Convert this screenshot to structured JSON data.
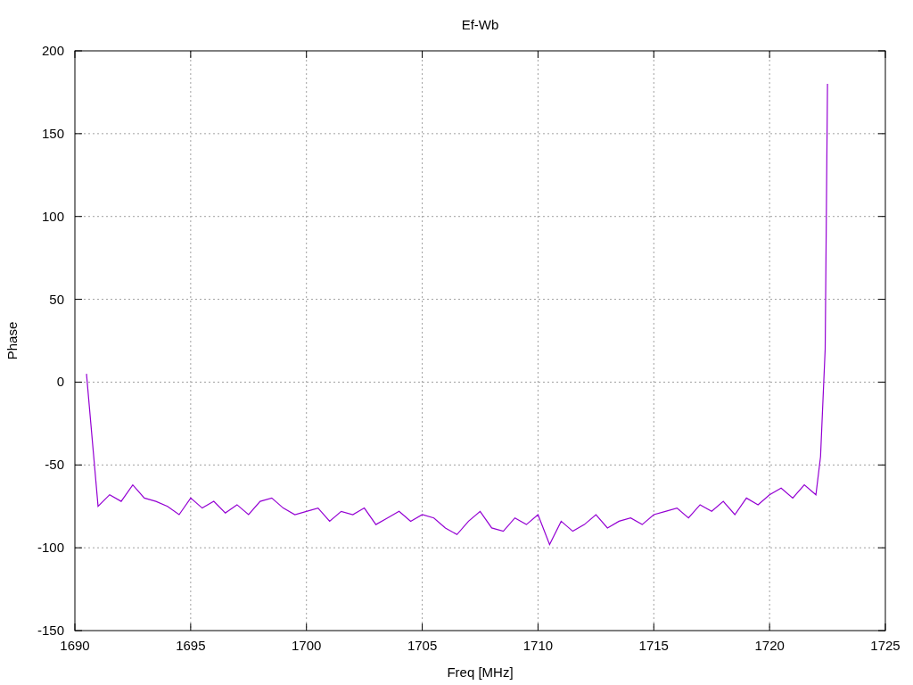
{
  "chart_data": {
    "type": "line",
    "title": "Ef-Wb",
    "xlabel": "Freq [MHz]",
    "ylabel": "Phase",
    "x": [
      1690.5,
      1691,
      1691.5,
      1692,
      1692.5,
      1693,
      1693.5,
      1694,
      1694.5,
      1695,
      1695.5,
      1696,
      1696.5,
      1697,
      1697.5,
      1698,
      1698.5,
      1699,
      1699.5,
      1700,
      1700.5,
      1701,
      1701.5,
      1702,
      1702.5,
      1703,
      1703.5,
      1704,
      1704.5,
      1705,
      1705.5,
      1706,
      1706.5,
      1707,
      1707.5,
      1708,
      1708.5,
      1709,
      1709.5,
      1710,
      1710.5,
      1711,
      1711.5,
      1712,
      1712.5,
      1713,
      1713.5,
      1714,
      1714.5,
      1715,
      1715.5,
      1716,
      1716.5,
      1717,
      1717.5,
      1718,
      1718.5,
      1719,
      1719.5,
      1720,
      1720.5,
      1721,
      1721.5,
      1722,
      1722.2,
      1722.4,
      1722.5
    ],
    "grid": true,
    "series": [
      {
        "color": "#9400d3",
        "values": [
          5,
          -75,
          -68,
          -72,
          -62,
          -70,
          -72,
          -75,
          -80,
          -70,
          -76,
          -72,
          -79,
          -74,
          -80,
          -72,
          -70,
          -76,
          -80,
          -78,
          -76,
          -84,
          -78,
          -80,
          -76,
          -86,
          -82,
          -78,
          -84,
          -80,
          -82,
          -88,
          -92,
          -84,
          -78,
          -88,
          -90,
          -82,
          -86,
          -80,
          -98,
          -84,
          -90,
          -86,
          -80,
          -88,
          -84,
          -82,
          -86,
          -80,
          -78,
          -76,
          -82,
          -74,
          -78,
          -72,
          -80,
          -70,
          -74,
          -68,
          -64,
          -70,
          -62,
          -68,
          -45,
          20,
          180
        ]
      }
    ],
    "xlim": [
      1690,
      1725
    ],
    "ylim": [
      -150,
      200
    ],
    "xticks": [
      1690,
      1695,
      1700,
      1705,
      1710,
      1715,
      1720,
      1725
    ],
    "yticks": [
      -150,
      -100,
      -50,
      0,
      50,
      100,
      150,
      200
    ]
  }
}
